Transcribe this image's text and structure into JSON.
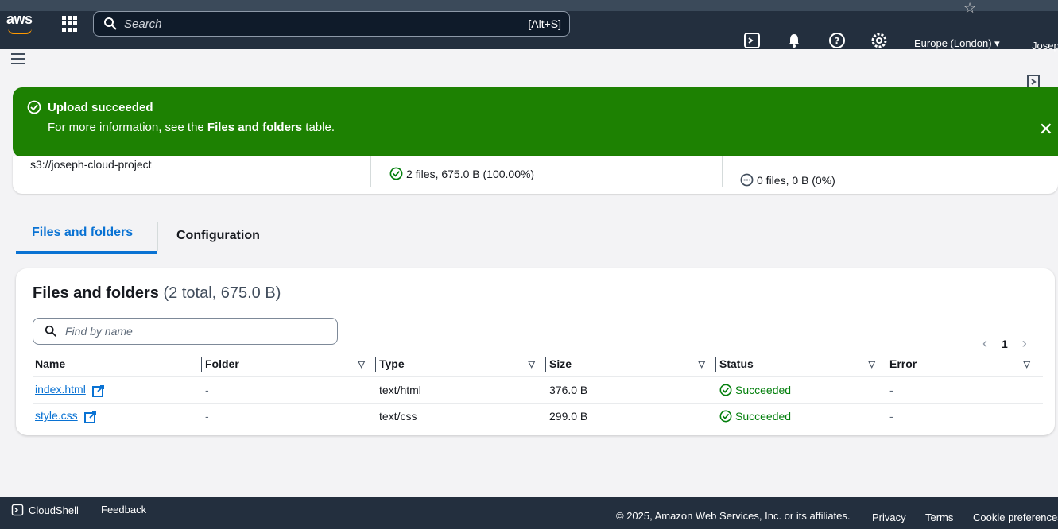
{
  "topbar": {
    "logo": "aws",
    "search_placeholder": "Search",
    "search_shortcut": "[Alt+S]",
    "region": "Europe (London) ▾",
    "user": "Josep"
  },
  "flash": {
    "title": "Upload succeeded",
    "message_prefix": "For more information, see the ",
    "message_bold": "Files and folders",
    "message_suffix": " table."
  },
  "summary": {
    "destination": "s3://joseph-cloud-project",
    "succeeded": "2 files, 675.0 B (100.00%)",
    "failed": "0 files, 0 B (0%)"
  },
  "tabs": [
    {
      "label": "Files and folders"
    },
    {
      "label": "Configuration"
    }
  ],
  "files_card": {
    "title": "Files and folders",
    "count": "(2 total, 675.0 B)",
    "filter_placeholder": "Find by name",
    "page": "1",
    "columns": [
      "Name",
      "Folder",
      "Type",
      "Size",
      "Status",
      "Error"
    ],
    "rows": [
      {
        "name": "index.html",
        "folder": "-",
        "type": "text/html",
        "size": "376.0 B",
        "status": "Succeeded",
        "error": "-"
      },
      {
        "name": "style.css",
        "folder": "-",
        "type": "text/css",
        "size": "299.0 B",
        "status": "Succeeded",
        "error": "-"
      }
    ]
  },
  "footer": {
    "cloudshell": "CloudShell",
    "feedback": "Feedback",
    "copyright": "© 2025, Amazon Web Services, Inc. or its affiliates.",
    "privacy": "Privacy",
    "terms": "Terms",
    "cookie": "Cookie preferences"
  },
  "colors": {
    "topbar_bg": "#232f3e",
    "flash_success": "#1d8102",
    "link_blue": "#0972d3",
    "status_green": "#037f0c"
  }
}
